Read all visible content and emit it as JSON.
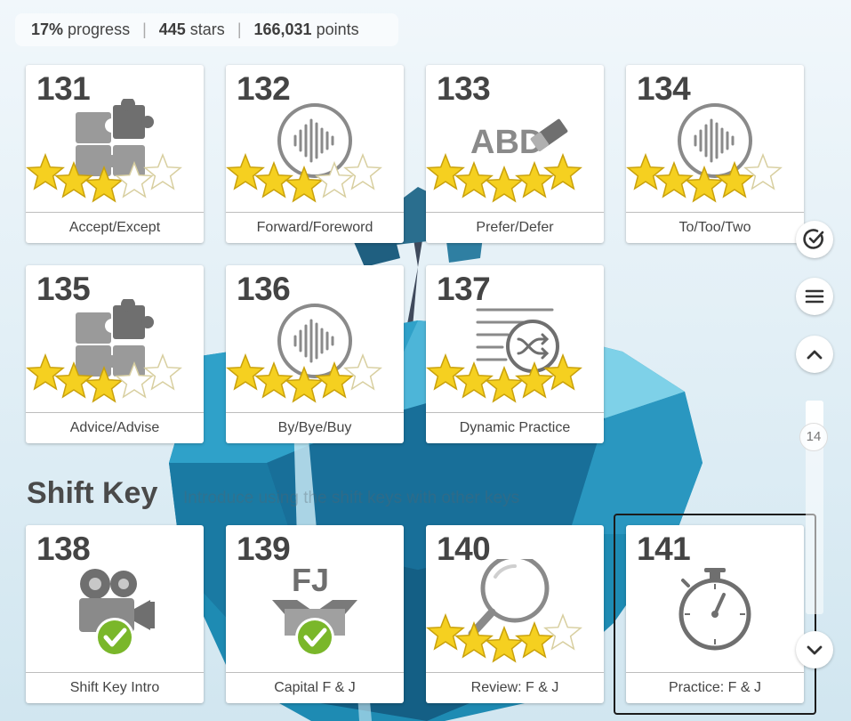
{
  "stats": {
    "progress_value": "17%",
    "progress_label": "progress",
    "stars_value": "445",
    "stars_label": "stars",
    "points_value": "166,031",
    "points_label": "points",
    "separator": "|"
  },
  "lessons": [
    {
      "number": "131",
      "label": "Accept/Except",
      "icon": "puzzle-icon",
      "stars": 3
    },
    {
      "number": "132",
      "label": "Forward/Foreword",
      "icon": "sound-wave-icon",
      "stars": 3
    },
    {
      "number": "133",
      "label": "Prefer/Defer",
      "icon": "abc-eraser-icon",
      "icon_text": "ABD",
      "stars": 5
    },
    {
      "number": "134",
      "label": "To/Too/Two",
      "icon": "sound-wave-icon",
      "stars": 4
    },
    {
      "number": "135",
      "label": "Advice/Advise",
      "icon": "puzzle-icon",
      "stars": 3
    },
    {
      "number": "136",
      "label": "By/Bye/Buy",
      "icon": "sound-wave-icon",
      "stars": 4
    },
    {
      "number": "137",
      "label": "Dynamic Practice",
      "icon": "shuffle-list-icon",
      "stars": 5
    }
  ],
  "section": {
    "title": "Shift Key",
    "subtitle": "Introduce using the shift keys with other keys"
  },
  "shift_lessons": [
    {
      "number": "138",
      "label": "Shift Key Intro",
      "icon": "video-camera-icon",
      "completed": true
    },
    {
      "number": "139",
      "label": "Capital F & J",
      "icon": "open-box-icon",
      "icon_text": "FJ",
      "completed": true
    },
    {
      "number": "140",
      "label": "Review: F & J",
      "icon": "magnifier-icon",
      "stars": 4
    },
    {
      "number": "141",
      "label": "Practice: F & J",
      "icon": "stopwatch-icon",
      "stars": 0,
      "selected": true
    }
  ],
  "sidebar": {
    "scroll_level": "14"
  },
  "colors": {
    "star_fill": "#f5d020",
    "check_green": "#7ab72a",
    "icon_gray": "#8a8a8a"
  }
}
